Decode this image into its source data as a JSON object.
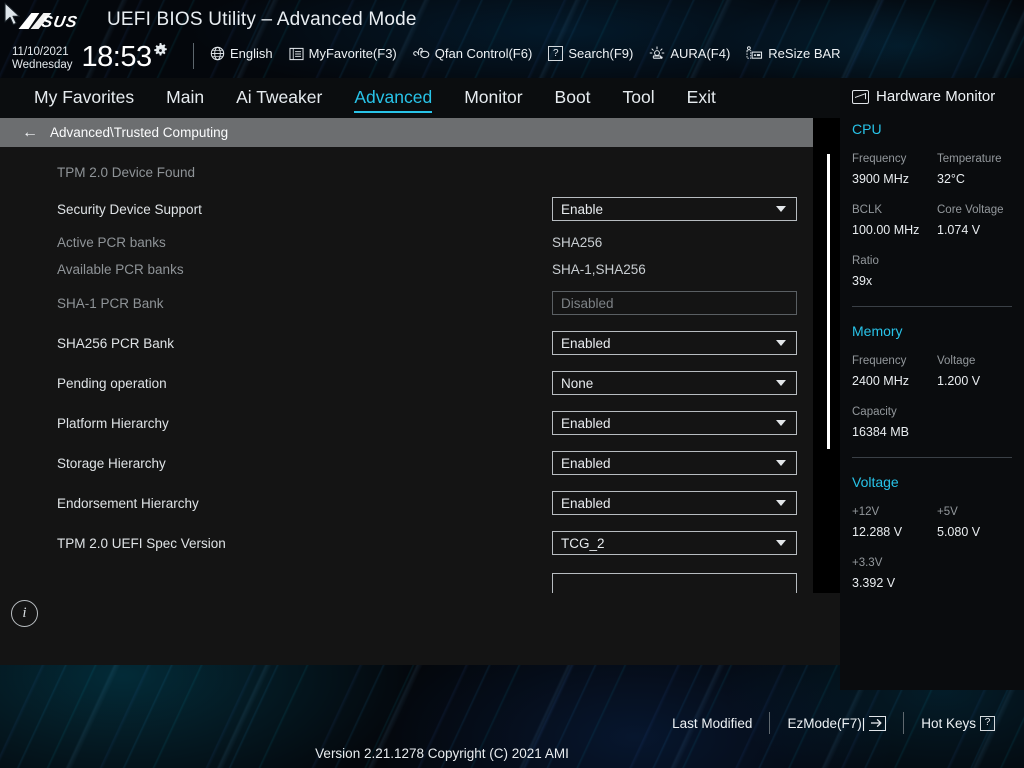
{
  "header": {
    "logo": "/ISUS",
    "title": "UEFI BIOS Utility – Advanced Mode",
    "date": "11/10/2021",
    "weekday": "Wednesday",
    "time": "18:53",
    "gear_icon": "gear-icon",
    "tools": [
      {
        "icon": "globe-icon",
        "label": "English"
      },
      {
        "icon": "list-icon",
        "label": "MyFavorite(F3)"
      },
      {
        "icon": "fan-icon",
        "label": "Qfan Control(F6)"
      },
      {
        "icon": "question-box-icon",
        "label": "Search(F9)"
      },
      {
        "icon": "aura-lamp-icon",
        "label": "AURA(F4)"
      },
      {
        "icon": "resize-bar-icon",
        "label": "ReSize BAR"
      }
    ]
  },
  "nav": {
    "tabs": [
      {
        "label": "My Favorites",
        "active": false
      },
      {
        "label": "Main",
        "active": false
      },
      {
        "label": "Ai Tweaker",
        "active": false
      },
      {
        "label": "Advanced",
        "active": true
      },
      {
        "label": "Monitor",
        "active": false
      },
      {
        "label": "Boot",
        "active": false
      },
      {
        "label": "Tool",
        "active": false
      },
      {
        "label": "Exit",
        "active": false
      }
    ]
  },
  "breadcrumb": {
    "back_icon": "back-arrow-icon",
    "path": "Advanced\\Trusted Computing"
  },
  "settings": {
    "rows": [
      {
        "type": "info",
        "label": "TPM 2.0 Device Found",
        "dim": true
      },
      {
        "type": "dropdown",
        "label": "Security Device Support",
        "value": "Enable",
        "enabled": true
      },
      {
        "type": "static",
        "label": "Active PCR banks",
        "value": "SHA256"
      },
      {
        "type": "static",
        "label": "Available PCR banks",
        "value": "SHA-1,SHA256"
      },
      {
        "type": "dropdown",
        "label": "SHA-1 PCR Bank",
        "value": "Disabled",
        "enabled": false
      },
      {
        "type": "dropdown",
        "label": "SHA256 PCR Bank",
        "value": "Enabled",
        "enabled": true
      },
      {
        "type": "dropdown",
        "label": "Pending operation",
        "value": "None",
        "enabled": true
      },
      {
        "type": "dropdown",
        "label": "Platform Hierarchy",
        "value": "Enabled",
        "enabled": true
      },
      {
        "type": "dropdown",
        "label": "Storage Hierarchy",
        "value": "Enabled",
        "enabled": true
      },
      {
        "type": "dropdown",
        "label": "Endorsement Hierarchy",
        "value": "Enabled",
        "enabled": true
      },
      {
        "type": "dropdown",
        "label": "TPM 2.0 UEFI Spec Version",
        "value": "TCG_2",
        "enabled": true
      }
    ]
  },
  "info_panel": {
    "icon": "info-icon",
    "icon_glyph": "i"
  },
  "hardware_monitor": {
    "icon": "monitor-icon",
    "title": "Hardware Monitor",
    "sections": [
      {
        "name": "CPU",
        "entries": [
          {
            "key": "Frequency",
            "value": "3900 MHz"
          },
          {
            "key": "Temperature",
            "value": "32°C"
          },
          {
            "key": "BCLK",
            "value": "100.00 MHz"
          },
          {
            "key": "Core Voltage",
            "value": "1.074 V"
          },
          {
            "key": "Ratio",
            "value": "39x"
          }
        ]
      },
      {
        "name": "Memory",
        "entries": [
          {
            "key": "Frequency",
            "value": "2400 MHz"
          },
          {
            "key": "Voltage",
            "value": "1.200 V"
          },
          {
            "key": "Capacity",
            "value": "16384 MB"
          }
        ]
      },
      {
        "name": "Voltage",
        "entries": [
          {
            "key": "+12V",
            "value": "12.288 V"
          },
          {
            "key": "+5V",
            "value": "5.080 V"
          },
          {
            "key": "+3.3V",
            "value": "3.392 V"
          }
        ]
      }
    ]
  },
  "footer": {
    "last_modified": "Last Modified",
    "ez_mode": "EzMode(F7)|",
    "ez_mode_icon": "arrow-into-box-icon",
    "hot_keys": "Hot Keys",
    "hot_keys_icon": "question-box-icon",
    "version": "Version 2.21.1278 Copyright (C) 2021 AMI"
  },
  "colors": {
    "accent": "#28c3e8",
    "panel_bg": "#141414",
    "breadcrumb_bg": "#6c6e70"
  }
}
